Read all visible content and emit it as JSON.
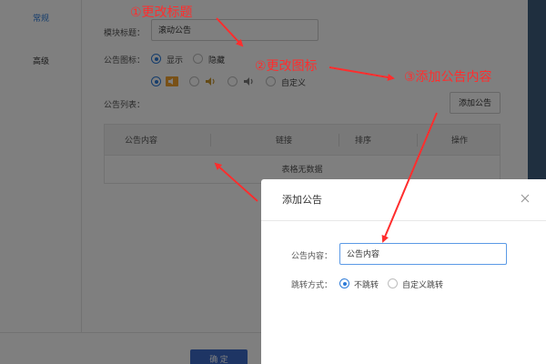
{
  "nav": {
    "items": [
      {
        "label": "常规",
        "active": true
      },
      {
        "label": "高级",
        "active": false
      }
    ]
  },
  "form": {
    "title_label": "模块标题：",
    "title_value": "滚动公告",
    "icon_label": "公告图标：",
    "visibility_options": [
      "显示",
      "隐藏"
    ],
    "visibility_selected": "显示",
    "icon_custom_label": "自定义",
    "list_label": "公告列表：",
    "add_button": "添加公告"
  },
  "table": {
    "columns": [
      "公告内容",
      "链接",
      "排序",
      "操作"
    ],
    "empty_text": "表格无数据"
  },
  "footer": {
    "confirm_button": "确 定"
  },
  "modal": {
    "title": "添加公告",
    "content_label": "公告内容：",
    "content_value": "公告内容",
    "jump_label": "跳转方式：",
    "jump_options": [
      "不跳转",
      "自定义跳转"
    ],
    "jump_selected": "不跳转"
  },
  "annotations": [
    "①更改标题",
    "②更改图标",
    "③添加公告内容"
  ],
  "colors": {
    "accent": "#2d7bd8",
    "primary_button": "#3c6bc9",
    "annotation": "#ff2d2d",
    "side_strip": "#3e5f7e"
  },
  "icons": [
    "speaker-icon",
    "close-icon",
    "arrow-icon"
  ]
}
